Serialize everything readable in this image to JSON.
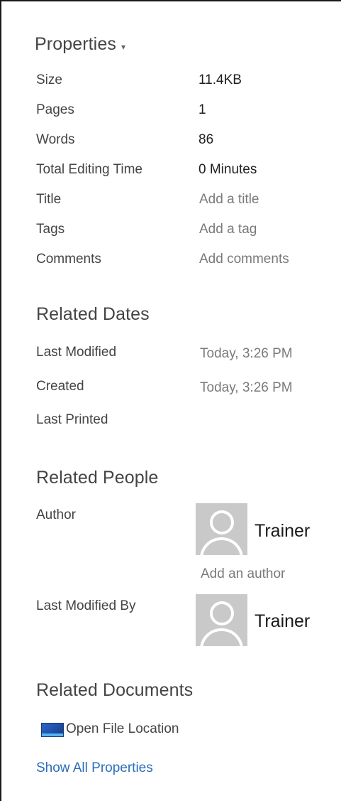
{
  "properties": {
    "heading": "Properties",
    "dropdown_glyph": "▾",
    "rows": [
      {
        "label": "Size",
        "value": "11.4KB"
      },
      {
        "label": "Pages",
        "value": "1"
      },
      {
        "label": "Words",
        "value": "86"
      },
      {
        "label": "Total Editing Time",
        "value": "0 Minutes"
      },
      {
        "label": "Title",
        "placeholder": "Add a title"
      },
      {
        "label": "Tags",
        "placeholder": "Add a tag"
      },
      {
        "label": "Comments",
        "placeholder": "Add comments"
      }
    ]
  },
  "related_dates": {
    "heading": "Related Dates",
    "rows": [
      {
        "label": "Last Modified",
        "value": "Today, 3:26 PM"
      },
      {
        "label": "Created",
        "value": "Today, 3:26 PM"
      },
      {
        "label": "Last Printed",
        "value": ""
      }
    ]
  },
  "related_people": {
    "heading": "Related People",
    "author_label": "Author",
    "author_name": "Trainer",
    "add_author": "Add an author",
    "last_modified_by_label": "Last Modified By",
    "last_modified_by_name": "Trainer",
    "avatar_icon": "person-placeholder-icon"
  },
  "related_documents": {
    "heading": "Related Documents",
    "open_file_location": "Open File Location",
    "folder_icon": "folder-location-icon",
    "show_all_properties": "Show All Properties"
  },
  "colors": {
    "text": "#444444",
    "value": "#1f1f1f",
    "placeholder": "#7a7a7a",
    "link": "#2a6ebb",
    "avatar_bg": "#c9c9c9"
  }
}
